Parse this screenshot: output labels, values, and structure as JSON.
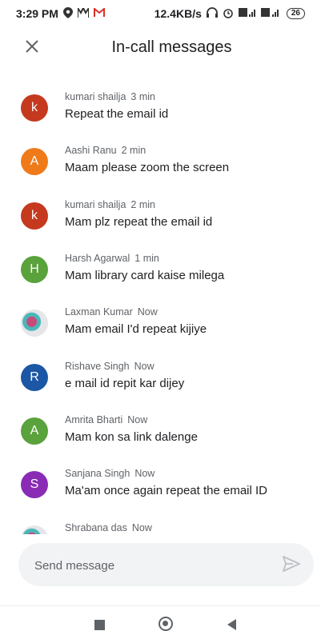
{
  "status_bar": {
    "time": "3:29 PM",
    "network_speed": "12.4KB/s",
    "battery": "26",
    "signal_label": "4G",
    "icons": [
      "location-icon",
      "meet-icon",
      "gmail-icon",
      "headphones-icon",
      "alarm-icon",
      "volte-icon",
      "signal-icon"
    ]
  },
  "header": {
    "title": "In-call messages",
    "close_icon": "close-icon"
  },
  "messages": [
    {
      "sender": "kumari shailja",
      "time": "3 min",
      "text": "Repeat the email id",
      "initial": "k",
      "color": "#c5391f"
    },
    {
      "sender": "Aashi Ranu",
      "time": "2 min",
      "text": "Maam please zoom the screen",
      "initial": "A",
      "color": "#ef7a1a"
    },
    {
      "sender": "kumari shailja",
      "time": "2 min",
      "text": "Mam plz repeat the email id",
      "initial": "k",
      "color": "#c5391f"
    },
    {
      "sender": "Harsh Agarwal",
      "time": "1 min",
      "text": "Mam library card kaise milega",
      "initial": "H",
      "color": "#5aa23c"
    },
    {
      "sender": "Laxman Kumar",
      "time": "Now",
      "text": "Mam email I'd repeat kijiye",
      "initial": "",
      "color": "#e6e6ea"
    },
    {
      "sender": "Rishave Singh",
      "time": "Now",
      "text": "e mail id repit kar dijey",
      "initial": "R",
      "color": "#1b57a5"
    },
    {
      "sender": "Amrita Bharti",
      "time": "Now",
      "text": "Mam kon sa link dalenge",
      "initial": "A",
      "color": "#5aa23c"
    },
    {
      "sender": "Sanjana Singh",
      "time": "Now",
      "text": "Ma'am once again repeat the email ID",
      "initial": "S",
      "color": "#8a2bb5"
    },
    {
      "sender": "Shrabana das",
      "time": "Now",
      "text": "",
      "initial": "",
      "color": "#e6e6ea"
    }
  ],
  "composer": {
    "placeholder": "Send message",
    "send_icon": "send-icon"
  },
  "nav_bar": {
    "icons": [
      "recents-icon",
      "home-icon",
      "back-icon"
    ]
  }
}
